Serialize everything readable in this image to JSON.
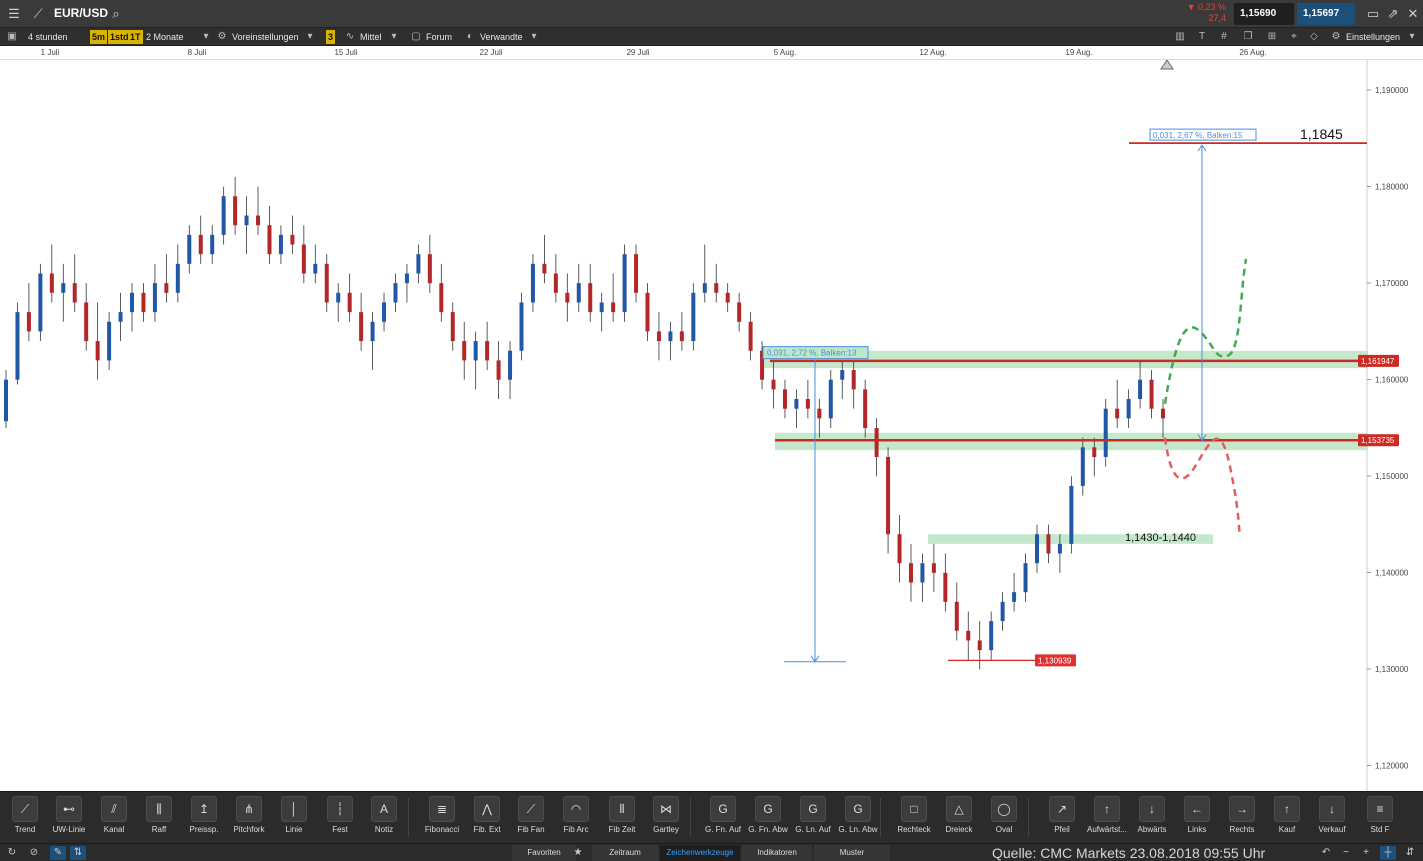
{
  "header": {
    "symbol": "EUR/USD",
    "change_percent": "▼ 0,23 %",
    "change_value": "27,4",
    "bid": "1,15690",
    "ask": "1,15697"
  },
  "toolbar": {
    "interval": "4 stunden",
    "period_buttons": [
      "5m",
      "1std",
      "1T"
    ],
    "range": "2 Monate",
    "presets": "Voreinstellungen",
    "count_badge": "3",
    "average": "Mittel",
    "forum": "Forum",
    "related": "Verwandte",
    "settings": "Einstellungen"
  },
  "date_axis": [
    {
      "label": "1 Juli"
    },
    {
      "label": "8 Juli"
    },
    {
      "label": "15 Juli"
    },
    {
      "label": "22 Juli"
    },
    {
      "label": "29 Juli"
    },
    {
      "label": "5 Aug."
    },
    {
      "label": "12 Aug."
    },
    {
      "label": "19 Aug."
    },
    {
      "label": "26 Aug."
    }
  ],
  "chart_data": {
    "type": "candlestick",
    "y_ticks": [
      "1,190000",
      "1,180000",
      "1,170000",
      "1,160000",
      "1,150000",
      "1,140000",
      "1,130000",
      "1,120000"
    ],
    "ylim": [
      1.116,
      1.193
    ],
    "candles_ohlc": [
      [
        1.1557,
        1.161,
        1.155,
        1.16
      ],
      [
        1.16,
        1.168,
        1.1595,
        1.167
      ],
      [
        1.167,
        1.17,
        1.164,
        1.165
      ],
      [
        1.165,
        1.172,
        1.164,
        1.171
      ],
      [
        1.171,
        1.174,
        1.168,
        1.169
      ],
      [
        1.169,
        1.172,
        1.166,
        1.17
      ],
      [
        1.17,
        1.173,
        1.167,
        1.168
      ],
      [
        1.168,
        1.17,
        1.163,
        1.164
      ],
      [
        1.164,
        1.168,
        1.16,
        1.162
      ],
      [
        1.162,
        1.167,
        1.161,
        1.166
      ],
      [
        1.166,
        1.169,
        1.164,
        1.167
      ],
      [
        1.167,
        1.17,
        1.165,
        1.169
      ],
      [
        1.169,
        1.17,
        1.166,
        1.167
      ],
      [
        1.167,
        1.172,
        1.166,
        1.17
      ],
      [
        1.17,
        1.173,
        1.168,
        1.169
      ],
      [
        1.169,
        1.174,
        1.168,
        1.172
      ],
      [
        1.172,
        1.176,
        1.171,
        1.175
      ],
      [
        1.175,
        1.177,
        1.172,
        1.173
      ],
      [
        1.173,
        1.176,
        1.172,
        1.175
      ],
      [
        1.175,
        1.18,
        1.174,
        1.179
      ],
      [
        1.179,
        1.181,
        1.175,
        1.176
      ],
      [
        1.176,
        1.179,
        1.173,
        1.177
      ],
      [
        1.177,
        1.18,
        1.175,
        1.176
      ],
      [
        1.176,
        1.178,
        1.172,
        1.173
      ],
      [
        1.173,
        1.176,
        1.172,
        1.175
      ],
      [
        1.175,
        1.177,
        1.173,
        1.174
      ],
      [
        1.174,
        1.176,
        1.17,
        1.171
      ],
      [
        1.171,
        1.174,
        1.17,
        1.172
      ],
      [
        1.172,
        1.173,
        1.167,
        1.168
      ],
      [
        1.168,
        1.17,
        1.166,
        1.169
      ],
      [
        1.169,
        1.171,
        1.166,
        1.167
      ],
      [
        1.167,
        1.169,
        1.163,
        1.164
      ],
      [
        1.164,
        1.167,
        1.161,
        1.166
      ],
      [
        1.166,
        1.169,
        1.165,
        1.168
      ],
      [
        1.168,
        1.171,
        1.167,
        1.17
      ],
      [
        1.17,
        1.172,
        1.168,
        1.171
      ],
      [
        1.171,
        1.174,
        1.17,
        1.173
      ],
      [
        1.173,
        1.175,
        1.169,
        1.17
      ],
      [
        1.17,
        1.172,
        1.166,
        1.167
      ],
      [
        1.167,
        1.168,
        1.163,
        1.164
      ],
      [
        1.164,
        1.166,
        1.16,
        1.162
      ],
      [
        1.162,
        1.165,
        1.159,
        1.164
      ],
      [
        1.164,
        1.166,
        1.161,
        1.162
      ],
      [
        1.162,
        1.164,
        1.158,
        1.16
      ],
      [
        1.16,
        1.164,
        1.158,
        1.163
      ],
      [
        1.163,
        1.169,
        1.162,
        1.168
      ],
      [
        1.168,
        1.173,
        1.167,
        1.172
      ],
      [
        1.172,
        1.175,
        1.17,
        1.171
      ],
      [
        1.171,
        1.173,
        1.168,
        1.169
      ],
      [
        1.169,
        1.171,
        1.166,
        1.168
      ],
      [
        1.168,
        1.172,
        1.167,
        1.17
      ],
      [
        1.17,
        1.172,
        1.166,
        1.167
      ],
      [
        1.167,
        1.169,
        1.165,
        1.168
      ],
      [
        1.168,
        1.171,
        1.166,
        1.167
      ],
      [
        1.167,
        1.174,
        1.166,
        1.173
      ],
      [
        1.173,
        1.174,
        1.168,
        1.169
      ],
      [
        1.169,
        1.17,
        1.164,
        1.165
      ],
      [
        1.165,
        1.167,
        1.162,
        1.164
      ],
      [
        1.164,
        1.166,
        1.162,
        1.165
      ],
      [
        1.165,
        1.167,
        1.163,
        1.164
      ],
      [
        1.164,
        1.17,
        1.163,
        1.169
      ],
      [
        1.169,
        1.174,
        1.168,
        1.17
      ],
      [
        1.17,
        1.172,
        1.168,
        1.169
      ],
      [
        1.169,
        1.17,
        1.167,
        1.168
      ],
      [
        1.168,
        1.169,
        1.165,
        1.166
      ],
      [
        1.166,
        1.167,
        1.162,
        1.163
      ],
      [
        1.163,
        1.164,
        1.159,
        1.16
      ],
      [
        1.16,
        1.162,
        1.157,
        1.159
      ],
      [
        1.159,
        1.16,
        1.156,
        1.157
      ],
      [
        1.157,
        1.159,
        1.155,
        1.158
      ],
      [
        1.158,
        1.16,
        1.156,
        1.157
      ],
      [
        1.157,
        1.158,
        1.154,
        1.156
      ],
      [
        1.156,
        1.161,
        1.155,
        1.16
      ],
      [
        1.16,
        1.162,
        1.158,
        1.161
      ],
      [
        1.161,
        1.162,
        1.157,
        1.159
      ],
      [
        1.159,
        1.16,
        1.154,
        1.155
      ],
      [
        1.155,
        1.156,
        1.15,
        1.152
      ],
      [
        1.152,
        1.153,
        1.142,
        1.144
      ],
      [
        1.144,
        1.146,
        1.139,
        1.141
      ],
      [
        1.141,
        1.143,
        1.137,
        1.139
      ],
      [
        1.139,
        1.142,
        1.137,
        1.141
      ],
      [
        1.141,
        1.143,
        1.138,
        1.14
      ],
      [
        1.14,
        1.142,
        1.136,
        1.137
      ],
      [
        1.137,
        1.139,
        1.133,
        1.134
      ],
      [
        1.134,
        1.136,
        1.131,
        1.133
      ],
      [
        1.133,
        1.135,
        1.13,
        1.132
      ],
      [
        1.132,
        1.136,
        1.131,
        1.135
      ],
      [
        1.135,
        1.138,
        1.134,
        1.137
      ],
      [
        1.137,
        1.14,
        1.136,
        1.138
      ],
      [
        1.138,
        1.142,
        1.137,
        1.141
      ],
      [
        1.141,
        1.145,
        1.14,
        1.144
      ],
      [
        1.144,
        1.145,
        1.141,
        1.142
      ],
      [
        1.142,
        1.144,
        1.14,
        1.143
      ],
      [
        1.143,
        1.15,
        1.142,
        1.149
      ],
      [
        1.149,
        1.154,
        1.148,
        1.153
      ],
      [
        1.153,
        1.154,
        1.15,
        1.152
      ],
      [
        1.152,
        1.158,
        1.151,
        1.157
      ],
      [
        1.157,
        1.16,
        1.155,
        1.156
      ],
      [
        1.156,
        1.159,
        1.155,
        1.158
      ],
      [
        1.158,
        1.162,
        1.157,
        1.16
      ],
      [
        1.16,
        1.161,
        1.156,
        1.157
      ],
      [
        1.157,
        1.158,
        1.154,
        1.156
      ]
    ],
    "levels": [
      {
        "value": 1.161947,
        "label": "1,161947",
        "color": "#cc2a22"
      },
      {
        "value": 1.153735,
        "label": "1,153735",
        "color": "#cc2a22"
      }
    ],
    "low_marker": {
      "value": 1.130939,
      "label": "1,130939"
    },
    "target_label": "1,1845",
    "target_value": 1.1845,
    "zone_label": "1,1430-1,1440",
    "zone_range": [
      1.143,
      1.144
    ],
    "measure_top": "0,031, 2,67 %, Balken:15",
    "measure_left": "0,031, 2,72 %, Balken:13",
    "colors": {
      "bull": "#2257a8",
      "bear": "#b3262a",
      "zone": "#bfe6c6",
      "measure": "#4a8fe0"
    }
  },
  "tools": [
    {
      "label": "Trend",
      "icon": "trend-line-icon",
      "glyph": "⟋"
    },
    {
      "label": "UW-Linie",
      "icon": "horizontal-line-icon",
      "glyph": "⊷"
    },
    {
      "label": "Kanal",
      "icon": "channel-icon",
      "glyph": "⫽"
    },
    {
      "label": "Raff",
      "icon": "raff-icon",
      "glyph": "⫼"
    },
    {
      "label": "Preissp.",
      "icon": "price-range-icon",
      "glyph": "↥"
    },
    {
      "label": "Pitchfork",
      "icon": "pitchfork-icon",
      "glyph": "⋔"
    },
    {
      "label": "Linie",
      "icon": "line-icon",
      "glyph": "│"
    },
    {
      "label": "Fest",
      "icon": "fixed-line-icon",
      "glyph": "┆"
    },
    {
      "label": "Notiz",
      "icon": "note-icon",
      "glyph": "A"
    },
    {
      "label": "Fibonacci",
      "icon": "fibonacci-icon",
      "glyph": "≣"
    },
    {
      "label": "Fib. Ext",
      "icon": "fib-extension-icon",
      "glyph": "⋀"
    },
    {
      "label": "Fib Fan",
      "icon": "fib-fan-icon",
      "glyph": "⟋"
    },
    {
      "label": "Fib Arc",
      "icon": "fib-arc-icon",
      "glyph": "◠"
    },
    {
      "label": "Fib Zeit",
      "icon": "fib-time-icon",
      "glyph": "⦀"
    },
    {
      "label": "Gartley",
      "icon": "gartley-icon",
      "glyph": "⋈"
    },
    {
      "label": "G. Fn. Auf",
      "icon": "gann-fan-up-icon",
      "glyph": "G"
    },
    {
      "label": "G. Fn. Abw",
      "icon": "gann-fan-down-icon",
      "glyph": "G"
    },
    {
      "label": "G. Ln. Auf",
      "icon": "gann-line-up-icon",
      "glyph": "G"
    },
    {
      "label": "G. Ln. Abw",
      "icon": "gann-line-down-icon",
      "glyph": "G"
    },
    {
      "label": "Rechteck",
      "icon": "rectangle-icon",
      "glyph": "□"
    },
    {
      "label": "Dreieck",
      "icon": "triangle-icon",
      "glyph": "△"
    },
    {
      "label": "Oval",
      "icon": "oval-icon",
      "glyph": "◯"
    },
    {
      "label": "Pfeil",
      "icon": "arrow-icon",
      "glyph": "↗"
    },
    {
      "label": "Aufwärtst...",
      "icon": "arrow-up-icon",
      "glyph": "↑"
    },
    {
      "label": "Abwärts",
      "icon": "arrow-down-icon",
      "glyph": "↓"
    },
    {
      "label": "Links",
      "icon": "arrow-left-icon",
      "glyph": "←"
    },
    {
      "label": "Rechts",
      "icon": "arrow-right-icon",
      "glyph": "→"
    },
    {
      "label": "Kauf",
      "icon": "buy-icon",
      "glyph": "↑"
    },
    {
      "label": "Verkauf",
      "icon": "sell-icon",
      "glyph": "↓"
    },
    {
      "label": "Std F",
      "icon": "standard-format-icon",
      "glyph": "≡"
    }
  ],
  "status_tabs": [
    "Favoriten",
    "Zeitraum",
    "Zeichenwerkzeuge",
    "Indikatoren",
    "Muster"
  ],
  "source_text": "Quelle: CMC Markets 23.08.2018 09:55 Uhr"
}
